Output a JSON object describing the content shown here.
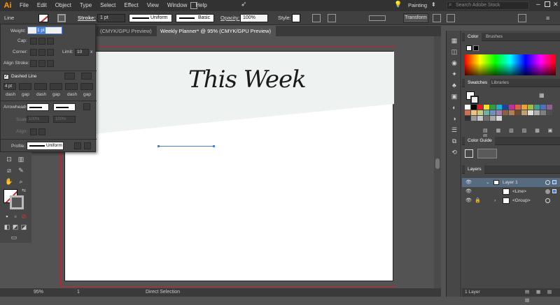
{
  "app": {
    "logo": "Ai"
  },
  "menu": [
    "File",
    "Edit",
    "Object",
    "Type",
    "Select",
    "Effect",
    "View",
    "Window",
    "Help"
  ],
  "workspace": {
    "label": "Painting",
    "search_placeholder": "Search Adobe Stock"
  },
  "control_bar": {
    "stroke_label": "Stroke:",
    "stroke_weight": "1 pt",
    "profile": "Uniform",
    "brush": "Basic",
    "opacity_label": "Opacity:",
    "opacity_value": "100%",
    "style_label": "Style:",
    "transform_label": "Transform"
  },
  "tabs": [
    {
      "label": "(CMYK/GPU Preview)",
      "close": "×"
    },
    {
      "label": "Weekly Planner* @ 95% (CMYK/GPU Preview)",
      "close": "×"
    }
  ],
  "stroke_panel": {
    "title": "Line",
    "weight_label": "Weight:",
    "weight_value": "1 pt",
    "cap_label": "Cap:",
    "corner_label": "Corner:",
    "limit_label": "Limit:",
    "limit_value": "10",
    "limit_unit": "x",
    "align_label": "Align Stroke:",
    "dashed_label": "Dashed Line",
    "dash_values": [
      "4 pt",
      "",
      "",
      "",
      "",
      ""
    ],
    "dash_labels": [
      "dash",
      "gap",
      "dash",
      "gap",
      "dash",
      "gap"
    ],
    "arrowheads_label": "Arrowheads:",
    "scale_label": "Scale:",
    "scale_values": [
      "100%",
      "100%"
    ],
    "align_arrow_label": "Align:",
    "profile_label": "Profile:",
    "profile_value": "Uniform"
  },
  "artboard": {
    "heading": "This Week"
  },
  "status": {
    "zoom": "95%",
    "page": "1",
    "tool": "Direct Selection"
  },
  "panels": {
    "color_tabs": [
      "Color",
      "Brushes"
    ],
    "swatch_tabs": [
      "Swatches",
      "Libraries"
    ],
    "color_guide": "Color Guide",
    "layers_tab": "Layers",
    "layers": [
      {
        "name": "Layer 1"
      },
      {
        "name": "<Line>"
      },
      {
        "name": "<Group>"
      }
    ],
    "layer_count": "1 Layer"
  },
  "colors": {
    "accent_red": "#c8222c",
    "mint": "#eef3f1",
    "selection_blue": "#4a7fd8"
  }
}
